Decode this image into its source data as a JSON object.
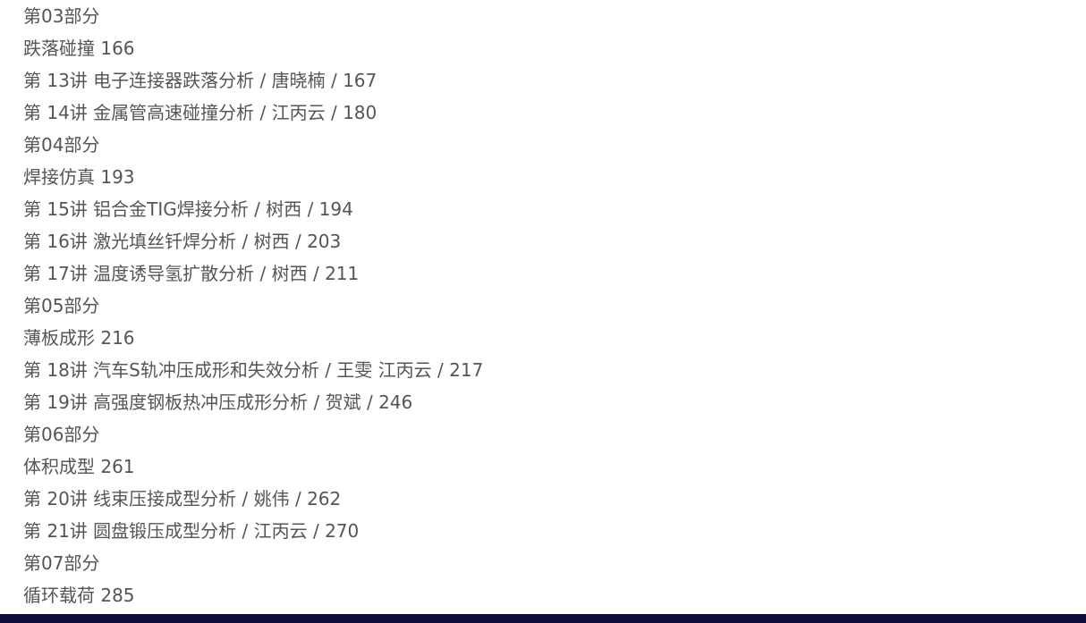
{
  "toc": {
    "lines": [
      "第03部分",
      "跌落碰撞 166",
      "第 13讲 电子连接器跌落分析 / 唐晓楠 / 167",
      "第 14讲 金属管高速碰撞分析 / 江丙云 / 180",
      "第04部分",
      "焊接仿真 193",
      "第 15讲 铝合金TIG焊接分析 / 树西 / 194",
      "第 16讲 激光填丝钎焊分析 / 树西 / 203",
      "第 17讲 温度诱导氢扩散分析 / 树西 / 211",
      "第05部分",
      "薄板成形 216",
      "第 18讲 汽车S轨冲压成形和失效分析 / 王雯 江丙云 / 217",
      "第 19讲 高强度钢板热冲压成形分析 / 贺斌 / 246",
      "第06部分",
      "体积成型 261",
      "第 20讲 线束压接成型分析 / 姚伟 / 262",
      "第 21讲 圆盘锻压成型分析 / 江丙云 / 270",
      "第07部分",
      "循环载荷 285"
    ]
  },
  "colors": {
    "text": "#555555",
    "background": "#ffffff",
    "bottom_bar": "#0d0b3a"
  }
}
